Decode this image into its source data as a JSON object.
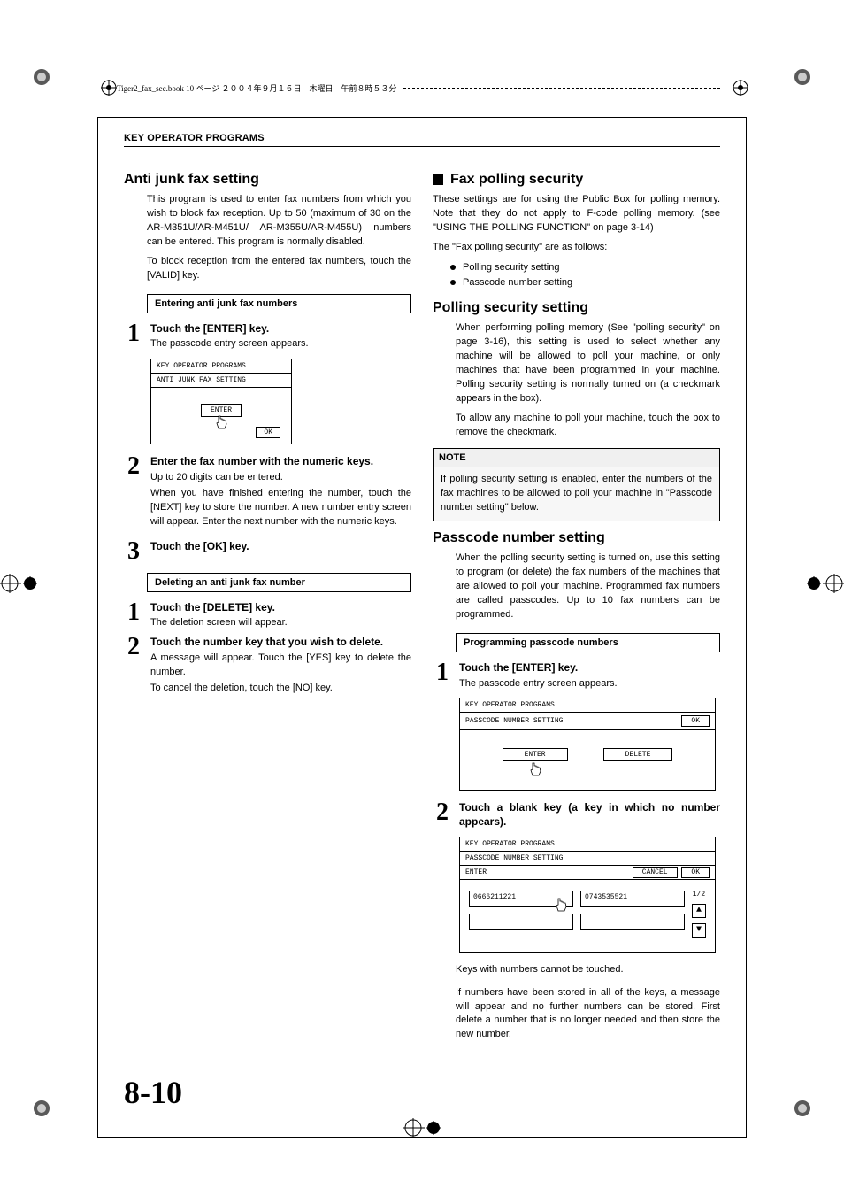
{
  "header": {
    "file_info": "Tiger2_fax_sec.book  10 ページ  ２００４年９月１６日　木曜日　午前８時５３分",
    "section": "KEY OPERATOR PROGRAMS"
  },
  "page_number": "8-10",
  "left": {
    "h2": "Anti junk fax setting",
    "intro": "This program is used to enter fax numbers from which you wish to block fax reception. Up to 50 (maximum of 30 on the AR-M351U/AR-M451U/ AR-M355U/AR-M455U) numbers can be entered. This program is normally disabled.",
    "intro2": "To block reception from the entered fax numbers, touch the [VALID] key.",
    "box1": "Entering anti junk fax numbers",
    "s1_title": "Touch the [ENTER] key.",
    "s1_text": "The passcode entry screen appears.",
    "screen1": {
      "title": "KEY OPERATOR PROGRAMS",
      "sub": "ANTI JUNK FAX SETTING",
      "enter": "ENTER",
      "ok": "OK"
    },
    "s2_title": "Enter the fax number with the numeric keys.",
    "s2_text": "Up to 20 digits can be entered.",
    "s2_text2": "When you have finished entering the number, touch the [NEXT] key to store the number. A new number entry screen will appear. Enter the next number with the numeric keys.",
    "s3_title": "Touch the [OK] key.",
    "box2": "Deleting an anti junk fax number",
    "d1_title": "Touch the [DELETE] key.",
    "d1_text": "The deletion screen will appear.",
    "d2_title": "Touch the number key that you wish to delete.",
    "d2_text": "A message will appear. Touch the [YES] key to delete the number.",
    "d2_text2": "To cancel the deletion, touch the [NO] key."
  },
  "right": {
    "h2": "Fax polling security",
    "intro": "These settings are for using the Public Box for polling memory. Note that they do not apply to F-code polling memory. (see \"USING THE POLLING FUNCTION\" on page 3-14)",
    "intro2": "The \"Fax polling security\" are as follows:",
    "bullets": [
      "Polling security setting",
      "Passcode number setting"
    ],
    "h2b": "Polling security setting",
    "pss": "When performing polling memory (See \"polling security\" on page 3-16), this setting is used to select whether any machine will be allowed to poll your machine, or only machines that have been programmed in your machine. Polling security setting is normally turned on (a checkmark appears in the box).",
    "pss2": "To allow any machine to poll your machine, touch the box to remove the checkmark.",
    "note_title": "NOTE",
    "note_body": "If polling security setting is enabled, enter the numbers of the fax machines to be allowed to poll your machine in \"Passcode number setting\" below.",
    "h2c": "Passcode number setting",
    "pns": "When the polling security setting is turned on, use this setting to program (or delete) the fax numbers of the machines that are allowed to poll your machine. Programmed fax numbers are called passcodes. Up to 10 fax numbers can be programmed.",
    "box1": "Programming passcode numbers",
    "s1_title": "Touch the [ENTER] key.",
    "s1_text": "The passcode entry screen appears.",
    "screen2": {
      "title": "KEY OPERATOR PROGRAMS",
      "sub": "PASSCODE NUMBER SETTING",
      "ok": "OK",
      "enter": "ENTER",
      "delete": "DELETE"
    },
    "s2_title": "Touch a blank key (a key in which no number appears).",
    "screen3": {
      "title": "KEY OPERATOR PROGRAMS",
      "sub": "PASSCODE NUMBER SETTING",
      "enter": "ENTER",
      "cancel": "CANCEL",
      "ok": "OK",
      "n1": "0666211221",
      "n2": "0743535521",
      "page": "1/2"
    },
    "after1": "Keys with numbers cannot be touched.",
    "after2": "If numbers have been stored in all of the keys, a message will appear and no further numbers can be stored. First delete a number that is no longer needed and then store the new number."
  }
}
